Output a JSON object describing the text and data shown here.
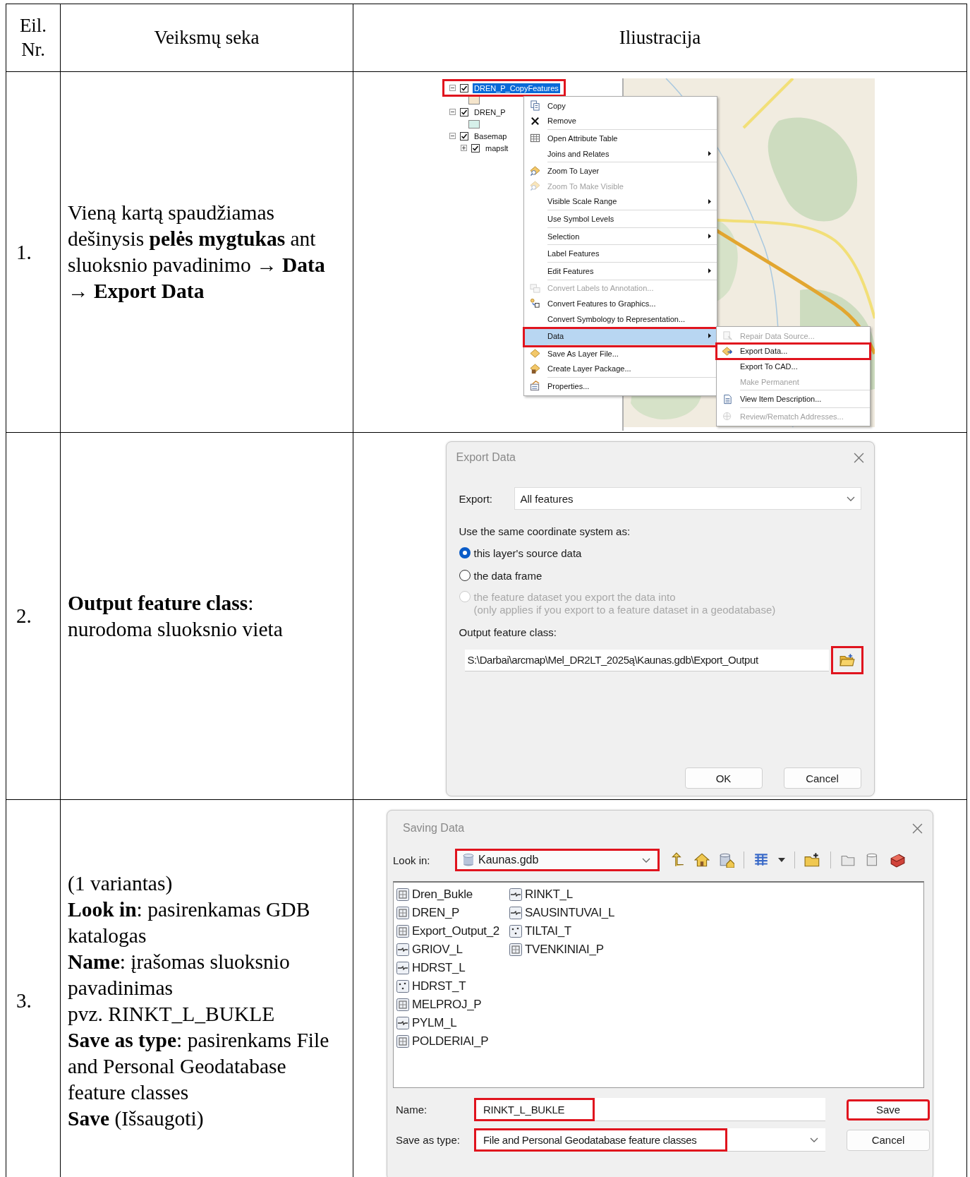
{
  "table": {
    "columns": [
      "Eil. Nr.",
      "Veiksmų seka",
      "Iliustracija"
    ],
    "rows": [
      {
        "number": "1.",
        "steps": [
          "Vieną kartą spaudžiamas dešinysis **pelės mygtukas** ant sluoksnio pavadinimo → **Data → Export Data**"
        ],
        "illustration": {
          "kind": "context_menu",
          "layers": [
            {
              "name": "DREN_P_CopyFeatures",
              "checked": true,
              "expanded": true,
              "selected": true,
              "marked": true,
              "color": "#f5e5cc"
            },
            {
              "name": "DREN_P",
              "checked": true,
              "expanded": true,
              "selected": false,
              "marked": false,
              "color": "#d6f0ea"
            },
            {
              "name": "Basemap",
              "checked": true,
              "expanded": true,
              "selected": false,
              "marked": false,
              "children": [
                {
                  "name": "mapslt",
                  "checked": true,
                  "expanded": false,
                  "selected": false,
                  "marked": false
                }
              ]
            }
          ],
          "menu": [
            {
              "label": "Copy",
              "disabled": false,
              "has_submenu": false,
              "selected": false,
              "marked": false,
              "separator_after": false
            },
            {
              "label": "Remove",
              "disabled": false,
              "has_submenu": false,
              "selected": false,
              "marked": false,
              "separator_after": true
            },
            {
              "label": "Open Attribute Table",
              "disabled": false,
              "has_submenu": false,
              "selected": false,
              "marked": false,
              "separator_after": false
            },
            {
              "label": "Joins and Relates",
              "disabled": false,
              "has_submenu": true,
              "selected": false,
              "marked": false,
              "separator_after": true
            },
            {
              "label": "Zoom To Layer",
              "disabled": false,
              "has_submenu": false,
              "selected": false,
              "marked": false,
              "separator_after": false
            },
            {
              "label": "Zoom To Make Visible",
              "disabled": true,
              "has_submenu": false,
              "selected": false,
              "marked": false,
              "separator_after": false
            },
            {
              "label": "Visible Scale Range",
              "disabled": false,
              "has_submenu": true,
              "selected": false,
              "marked": false,
              "separator_after": true
            },
            {
              "label": "Use Symbol Levels",
              "disabled": false,
              "has_submenu": false,
              "selected": false,
              "marked": false,
              "separator_after": true
            },
            {
              "label": "Selection",
              "disabled": false,
              "has_submenu": true,
              "selected": false,
              "marked": false,
              "separator_after": true
            },
            {
              "label": "Label Features",
              "disabled": false,
              "has_submenu": false,
              "selected": false,
              "marked": false,
              "separator_after": true
            },
            {
              "label": "Edit Features",
              "disabled": false,
              "has_submenu": true,
              "selected": false,
              "marked": false,
              "separator_after": true
            },
            {
              "label": "Convert Labels to Annotation...",
              "disabled": true,
              "has_submenu": false,
              "selected": false,
              "marked": false,
              "separator_after": false
            },
            {
              "label": "Convert Features to Graphics...",
              "disabled": false,
              "has_submenu": false,
              "selected": false,
              "marked": false,
              "separator_after": false
            },
            {
              "label": "Convert Symbology to Representation...",
              "disabled": false,
              "has_submenu": false,
              "selected": false,
              "marked": false,
              "separator_after": true
            },
            {
              "label": "Data",
              "disabled": false,
              "has_submenu": true,
              "selected": true,
              "marked": true,
              "separator_after": true
            },
            {
              "label": "Save As Layer File...",
              "disabled": false,
              "has_submenu": false,
              "selected": false,
              "marked": false,
              "separator_after": false
            },
            {
              "label": "Create Layer Package...",
              "disabled": false,
              "has_submenu": false,
              "selected": false,
              "marked": false,
              "separator_after": true
            },
            {
              "label": "Properties...",
              "disabled": false,
              "has_submenu": false,
              "selected": false,
              "marked": false,
              "separator_after": false
            }
          ],
          "submenu": [
            {
              "label": "Repair Data Source...",
              "disabled": true,
              "selected": false,
              "marked": false,
              "separator_after": false
            },
            {
              "label": "Export Data...",
              "disabled": false,
              "selected": false,
              "marked": true,
              "separator_after": false
            },
            {
              "label": "Export To CAD...",
              "disabled": false,
              "selected": false,
              "marked": false,
              "separator_after": false
            },
            {
              "label": "Make Permanent",
              "disabled": true,
              "selected": false,
              "marked": false,
              "separator_after": true
            },
            {
              "label": "View Item Description...",
              "disabled": false,
              "selected": false,
              "marked": false,
              "separator_after": true
            },
            {
              "label": "Review/Rematch Addresses...",
              "disabled": true,
              "selected": false,
              "marked": false,
              "separator_after": false
            }
          ]
        }
      },
      {
        "number": "2.",
        "steps": [
          "**Output feature class**: nurodoma sluoksnio vieta"
        ],
        "illustration": {
          "kind": "export_dialog",
          "title": "Export Data",
          "export_label": "Export:",
          "export_value": "All features",
          "coordinate_label": "Use the same coordinate system as:",
          "options": [
            {
              "label": "this layer's source data",
              "selected": true,
              "disabled": false
            },
            {
              "label": "the data frame",
              "selected": false,
              "disabled": false
            },
            {
              "label": "the feature dataset you export the data into",
              "note": "(only applies if you export to a feature dataset in a geodatabase)",
              "selected": false,
              "disabled": true
            }
          ],
          "output_label": "Output feature class:",
          "output_path": "S:\\Darbai\\arcmap\\Mel_DR2LT_2025ą\\Kaunas.gdb\\Export_Output",
          "browse_marked": true,
          "buttons": [
            "OK",
            "Cancel"
          ]
        }
      },
      {
        "number": "3.",
        "steps": [
          "(1 variantas)",
          "**Look in**: pasirenkamas GDB katalogas",
          "**Name**: įrašomas sluoksnio pavadinimas",
          "pvz. RINKT_L_BUKLE",
          "**Save as type**: pasirenkams File and Personal Geodatabase feature classes",
          "**Save** (Išsaugoti)"
        ],
        "illustration": {
          "kind": "save_dialog",
          "title": "Saving Data",
          "look_in_label": "Look in:",
          "look_in_value": "Kaunas.gdb",
          "look_in_marked": true,
          "items": [
            {
              "name": "Dren_Bukle",
              "kind": "polygon"
            },
            {
              "name": "DREN_P",
              "kind": "polygon"
            },
            {
              "name": "Export_Output_2",
              "kind": "polygon"
            },
            {
              "name": "GRIOV_L",
              "kind": "line"
            },
            {
              "name": "HDRST_L",
              "kind": "line"
            },
            {
              "name": "HDRST_T",
              "kind": "point"
            },
            {
              "name": "MELPROJ_P",
              "kind": "polygon"
            },
            {
              "name": "PYLM_L",
              "kind": "line"
            },
            {
              "name": "POLDERIAI_P",
              "kind": "polygon"
            },
            {
              "name": "RINKT_L",
              "kind": "line"
            },
            {
              "name": "SAUSINTUVAI_L",
              "kind": "line"
            },
            {
              "name": "TILTAI_T",
              "kind": "point"
            },
            {
              "name": "TVENKINIAI_P",
              "kind": "polygon"
            }
          ],
          "name_label": "Name:",
          "name_value": "RINKT_L_BUKLE",
          "name_marked": true,
          "type_label": "Save as type:",
          "type_value": "File and Personal Geodatabase feature classes",
          "type_marked": true,
          "buttons": [
            {
              "label": "Save",
              "marked": true
            },
            {
              "label": "Cancel",
              "marked": false
            }
          ]
        }
      }
    ]
  }
}
